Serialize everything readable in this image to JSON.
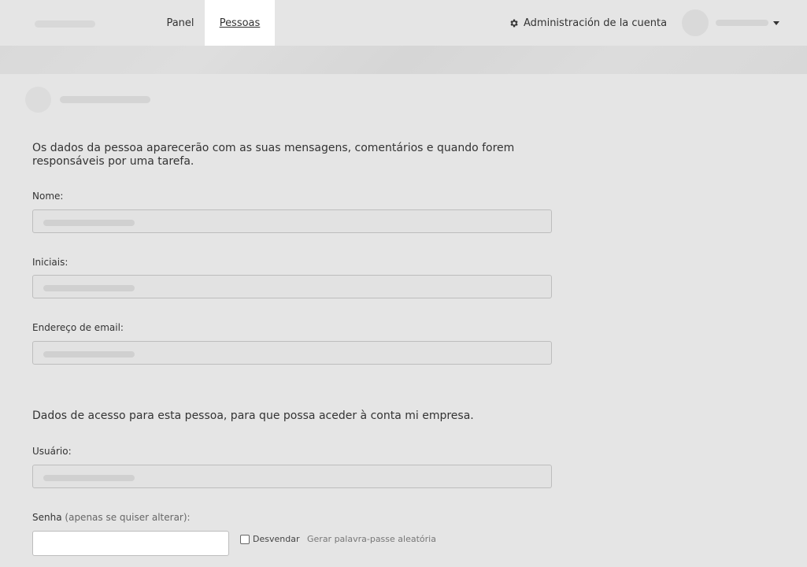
{
  "topbar": {
    "nav": {
      "panel_label": "Panel",
      "pessoas_label": "Pessoas",
      "admin_label": "Administración de la cuenta"
    }
  },
  "form": {
    "intro_text": "Os dados da pessoa aparecerão com as suas mensagens, comentários e quando forem responsáveis por uma tarefa.",
    "name_label": "Nome:",
    "initials_label": "Iniciais:",
    "email_label": "Endereço de email:",
    "access_text": "Dados de acesso para esta pessoa, para que possa aceder à conta mi empresa.",
    "user_label": "Usuário:",
    "password_label": "Senha",
    "password_hint": "(apenas se quiser alterar):",
    "reveal_label": "Desvendar",
    "generate_label": "Gerar palavra-passe aleatória"
  }
}
